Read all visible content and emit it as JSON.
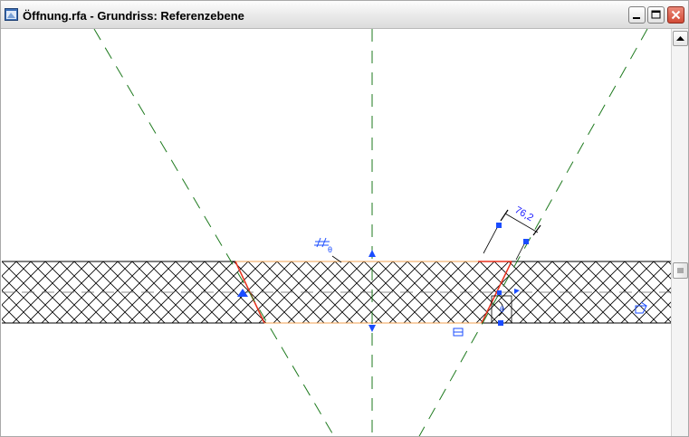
{
  "window": {
    "title": "Öffnung.rfa - Grundriss: Referenzebene",
    "controls": [
      "minimize",
      "maximize",
      "close"
    ]
  },
  "drawing": {
    "dimension_value": "76,2",
    "opening_label": "θ",
    "colors": {
      "reference_plane": "#1e7a1e",
      "opening_edge": "#e8321e",
      "annotation": "#1a1aff",
      "hatch": "#000000"
    }
  },
  "icons": {
    "app": "revit-family-icon",
    "minimize": "minimize-icon",
    "maximize": "maximize-icon",
    "close": "close-icon",
    "scroll_up": "arrow-up-icon"
  }
}
